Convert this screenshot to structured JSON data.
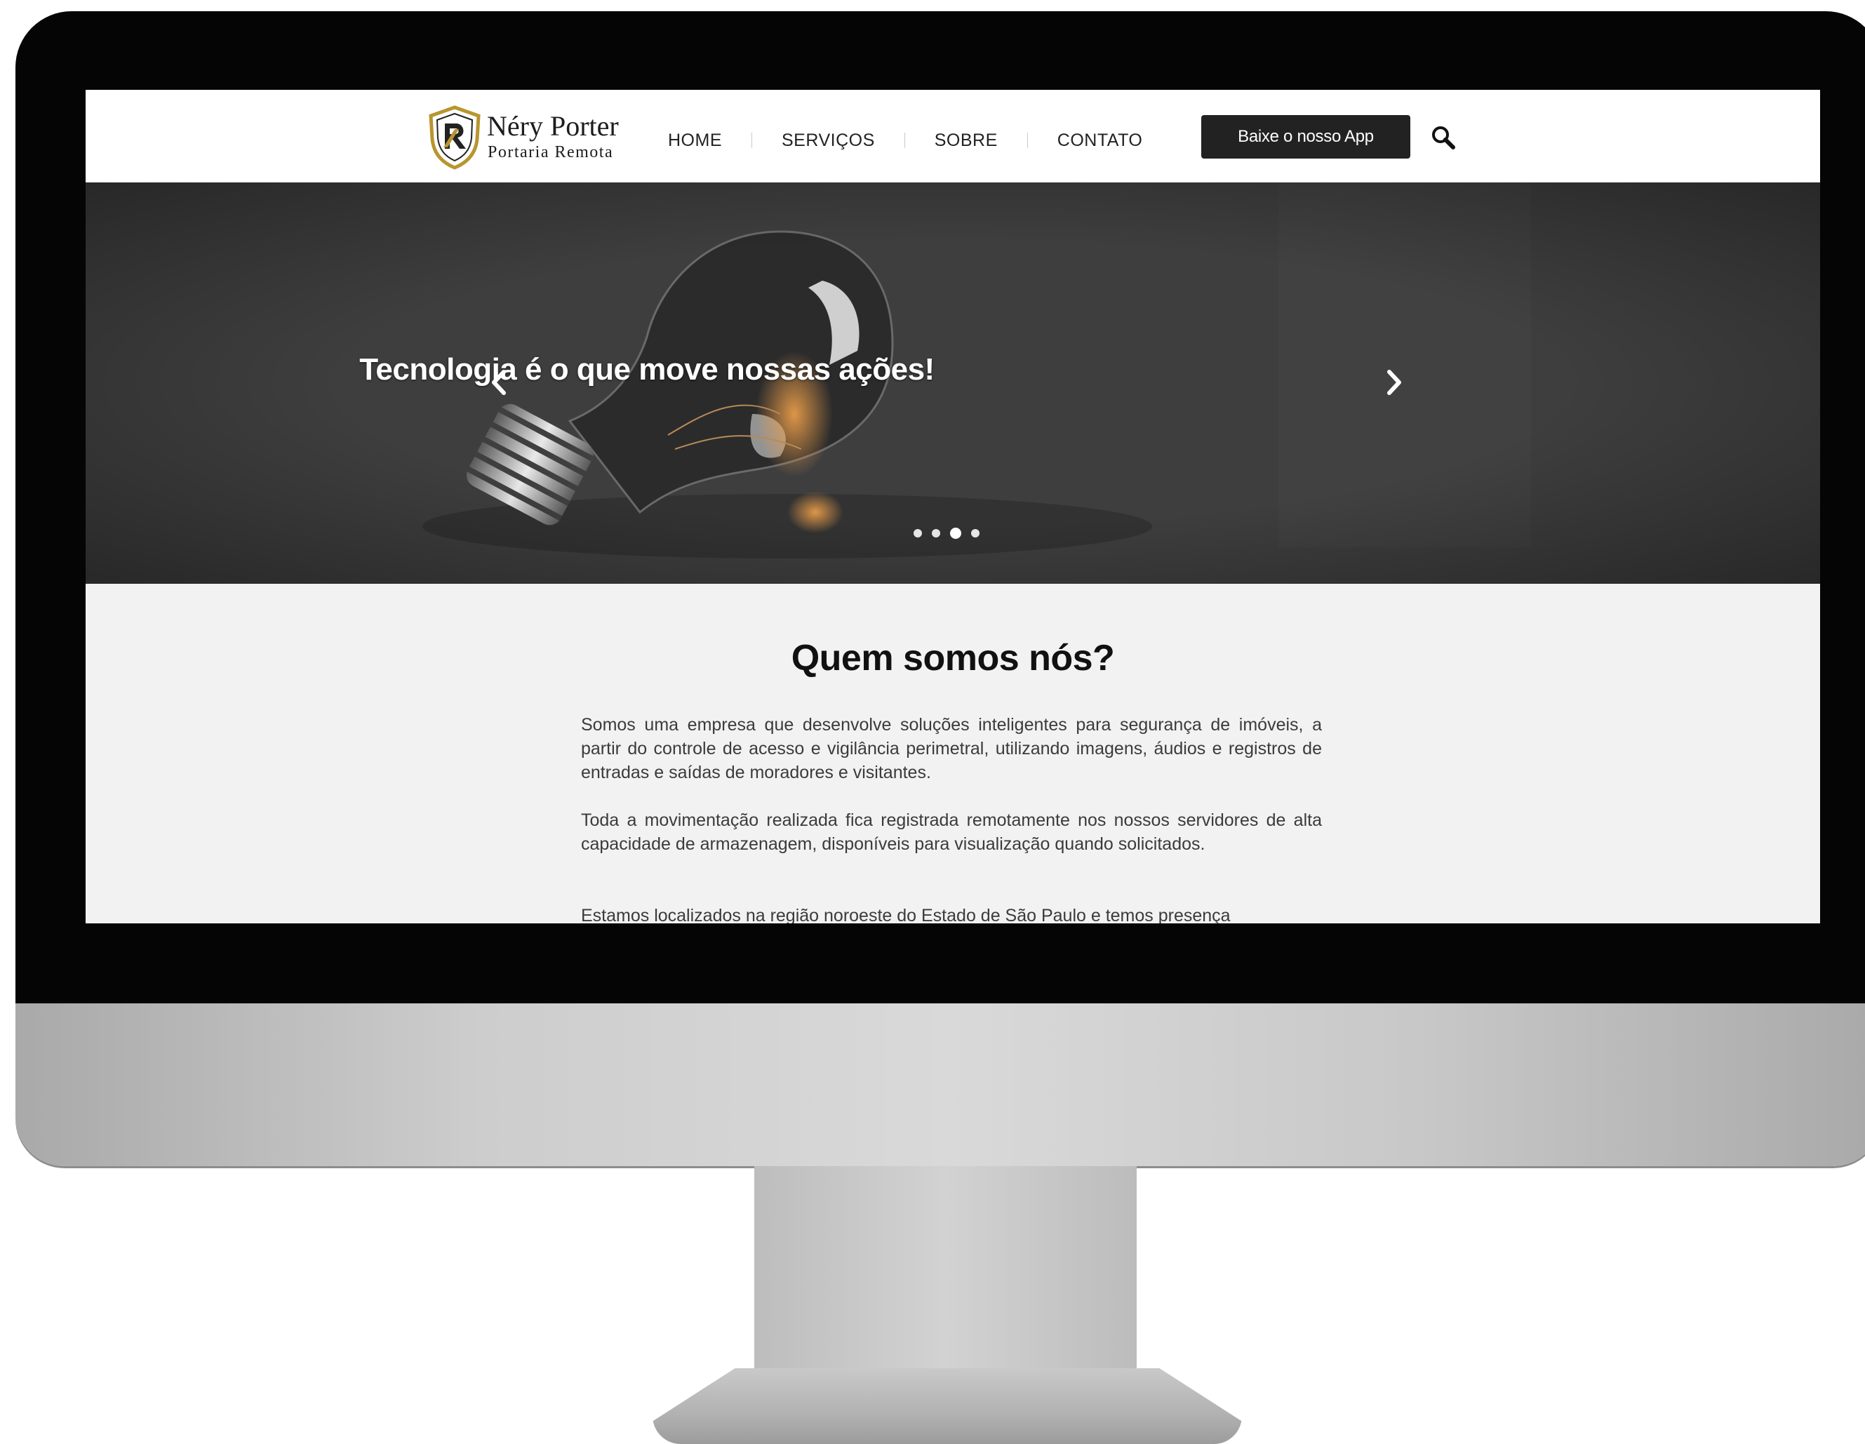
{
  "brand": {
    "name": "Néry Porter",
    "tagline": "Portaria Remota",
    "colors": {
      "gold": "#b8962e",
      "dark": "#222222"
    }
  },
  "nav": {
    "items": [
      {
        "label": "HOME"
      },
      {
        "label": "SERVIÇOS"
      },
      {
        "label": "SOBRE"
      },
      {
        "label": "CONTATO"
      }
    ],
    "app_button": "Baixe o nosso App",
    "search_icon": "search-icon"
  },
  "hero": {
    "title": "Tecnologia é o que move nossas ações!",
    "prev_icon": "chevron-left-icon",
    "next_icon": "chevron-right-icon",
    "slide_count": 4,
    "active_slide": 3
  },
  "about": {
    "title": "Quem somos nós?",
    "paragraphs": [
      "Somos uma empresa que desenvolve soluções inteligentes para segurança de imóveis, a partir do controle de acesso e vigilância perimetral, utilizando imagens, áudios e registros de entradas e saídas de moradores e visitantes.",
      "Toda a movimentação realizada fica registrada remotamente nos nossos servidores de alta capacidade de armazenagem, disponíveis para visualização quando solicitados.",
      "Estamos localizados na região noroeste do Estado de São Paulo e temos presença"
    ]
  }
}
